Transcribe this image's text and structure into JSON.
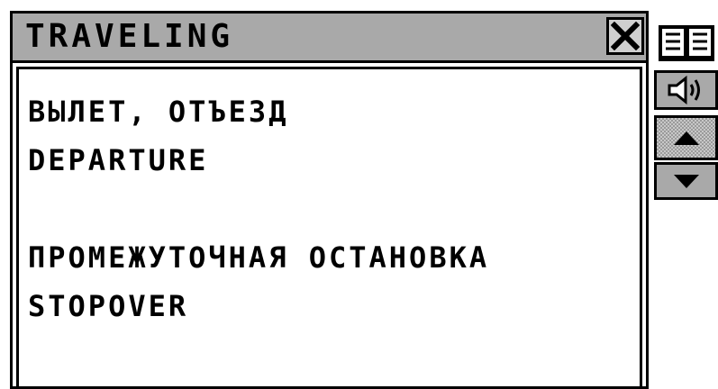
{
  "window": {
    "title": "TRAVELING",
    "close_icon": "close-icon"
  },
  "content": {
    "lines": [
      "ВЫЛЕТ, ОТЪЕЗД",
      "DEPARTURE",
      "",
      "ПРОМЕЖУТОЧНАЯ ОСТАНОВКА",
      "STOPOVER"
    ]
  },
  "sidebar": {
    "icons": [
      "book-icon",
      "speaker-icon",
      "arrow-up-icon",
      "arrow-down-icon"
    ]
  },
  "colors": {
    "titlebar": "#a9a9a9",
    "background": "#ffffff",
    "foreground": "#000000"
  }
}
